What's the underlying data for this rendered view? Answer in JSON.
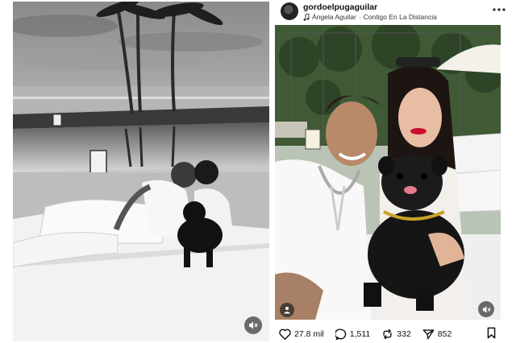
{
  "post": {
    "username": "gordoelpugaguilar",
    "song_artist": "Ángela Aguilar",
    "song_separator": "·",
    "song_title": "Contigo En La Distancia",
    "more_icon": "more-horizontal-icon"
  },
  "actions": {
    "likes": "27.8 mil",
    "comments": "1,511",
    "reposts": "332",
    "shares": "852"
  },
  "icons": {
    "like": "heart-icon",
    "comment": "comment-bubble-icon",
    "repost": "repost-icon",
    "share": "send-icon",
    "save": "bookmark-icon",
    "mute": "speaker-muted-icon",
    "tag": "person-tag-icon",
    "music": "music-note-icon"
  },
  "colors": {
    "text": "#111111",
    "overlay": "#3c3c3c",
    "lips": "#c8102e"
  }
}
